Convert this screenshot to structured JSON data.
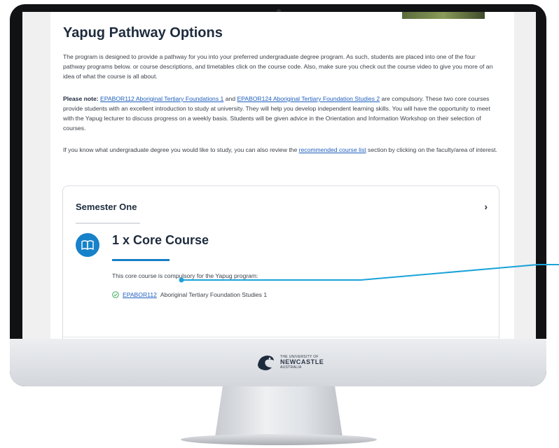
{
  "page": {
    "title": "Yapug Pathway Options",
    "intro": "The program is designed to provide a pathway for you into your preferred undergraduate degree program. As such, students are placed into one of the four pathway programs below. or course descriptions, and timetables click on the course code. Also, make sure you check out the course video to give you more of an idea of what the course is all about.",
    "note_label": "Please note:",
    "note_link_1": "EPABOR112 Aboriginal Tertiary Foundations 1",
    "note_and": " and ",
    "note_link_2": "EPABOR124 Aboriginal Tertiary Foundation Studies 2",
    "note_rest": " are compulsory. These two core courses provide students with an excellent introduction to study at university. They will help you develop independent learning skills. You will have the opportunity to meet with the Yapug lecturer to discuss progress on a weekly basis. Students will be given advice in the Orientation and Information Workshop on their selection of courses.",
    "p3_before": "If you know what undergraduate degree you would like to study, you can also review the ",
    "p3_link": "recommended course list",
    "p3_after": " section by clicking on the faculty/area of interest."
  },
  "card": {
    "heading": "Semester One",
    "chevron": "›",
    "core_title": "1 x Core Course",
    "core_desc": "This core course is compulsory for the Yapug program:",
    "course_code": "EPABOR112",
    "course_name": "Aboriginal Tertiary Foundation Studies 1"
  },
  "monitor": {
    "logo_small": "THE UNIVERSITY OF",
    "logo_name": "NEWCASTLE",
    "logo_country": "AUSTRALIA"
  },
  "colors": {
    "accent": "#1781c9",
    "link": "#1f5fbf",
    "heading": "#1e2b3d",
    "callout": "#1aa3d9"
  },
  "icons": {
    "book": "book-icon",
    "check": "check-circle-icon",
    "chevron": "chevron-right-icon",
    "logo": "university-logo-icon"
  }
}
